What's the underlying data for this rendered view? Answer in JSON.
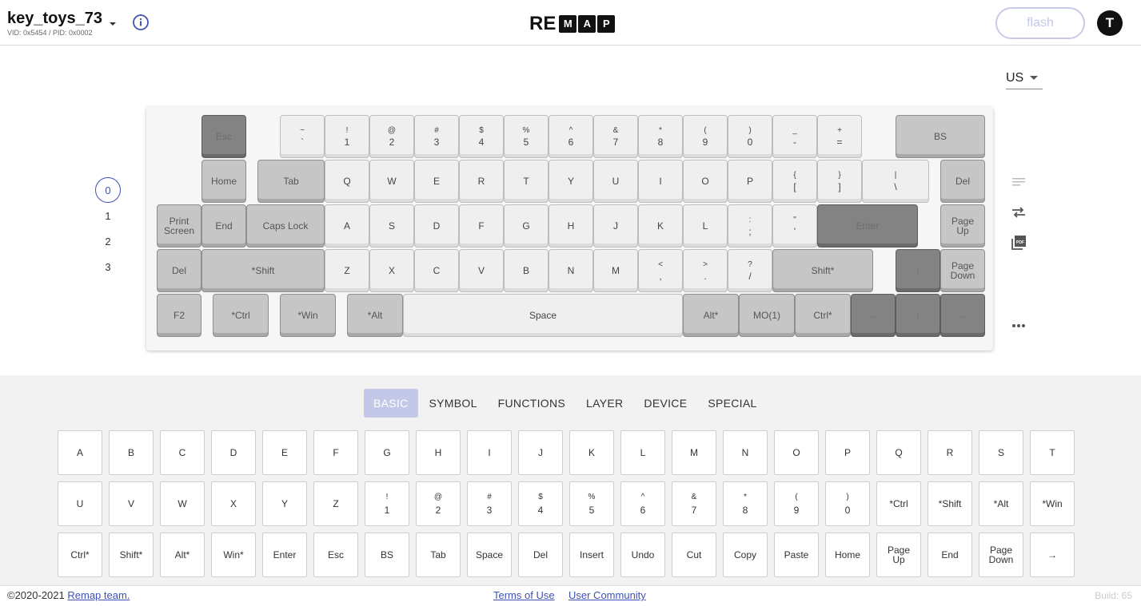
{
  "header": {
    "keyboard_name": "key_toys_73",
    "keyboard_ids": "VID: 0x5454 / PID: 0x0002",
    "logo_re": "RE",
    "logo_letters": [
      "M",
      "A",
      "P"
    ],
    "flash_label": "flash",
    "avatar_initial": "T"
  },
  "keymap": {
    "layout_value": "US",
    "layers": [
      "0",
      "1",
      "2",
      "3"
    ],
    "active_layer": "0",
    "rows": [
      [
        {
          "top": "",
          "label": "Esc",
          "style": "dark"
        },
        {
          "top": "~",
          "label": "`",
          "style": "light"
        },
        {
          "top": "!",
          "label": "1",
          "style": "light"
        },
        {
          "top": "@",
          "label": "2",
          "style": "light"
        },
        {
          "top": "#",
          "label": "3",
          "style": "light"
        },
        {
          "top": "$",
          "label": "4",
          "style": "light"
        },
        {
          "top": "%",
          "label": "5",
          "style": "light"
        },
        {
          "top": "^",
          "label": "6",
          "style": "light"
        },
        {
          "top": "&",
          "label": "7",
          "style": "light"
        },
        {
          "top": "*",
          "label": "8",
          "style": "light"
        },
        {
          "top": "(",
          "label": "9",
          "style": "light"
        },
        {
          "top": ")",
          "label": "0",
          "style": "light"
        },
        {
          "top": "_",
          "label": "-",
          "style": "light"
        },
        {
          "top": "+",
          "label": "=",
          "style": "light"
        },
        {
          "top": "",
          "label": "BS",
          "style": "mid"
        }
      ],
      [
        {
          "top": "",
          "label": "Home",
          "style": "mid"
        },
        {
          "top": "",
          "label": "Tab",
          "style": "mid"
        },
        {
          "top": "",
          "label": "Q",
          "style": "light"
        },
        {
          "top": "",
          "label": "W",
          "style": "light"
        },
        {
          "top": "",
          "label": "E",
          "style": "light"
        },
        {
          "top": "",
          "label": "R",
          "style": "light"
        },
        {
          "top": "",
          "label": "T",
          "style": "light"
        },
        {
          "top": "",
          "label": "Y",
          "style": "light"
        },
        {
          "top": "",
          "label": "U",
          "style": "light"
        },
        {
          "top": "",
          "label": "I",
          "style": "light"
        },
        {
          "top": "",
          "label": "O",
          "style": "light"
        },
        {
          "top": "",
          "label": "P",
          "style": "light"
        },
        {
          "top": "{",
          "label": "[",
          "style": "light"
        },
        {
          "top": "}",
          "label": "]",
          "style": "light"
        },
        {
          "top": "|",
          "label": "\\",
          "style": "light"
        },
        {
          "top": "",
          "label": "Del",
          "style": "mid"
        }
      ],
      [
        {
          "top": "",
          "label": "Print Screen",
          "style": "mid"
        },
        {
          "top": "",
          "label": "End",
          "style": "mid"
        },
        {
          "top": "",
          "label": "Caps Lock",
          "style": "mid"
        },
        {
          "top": "",
          "label": "A",
          "style": "light"
        },
        {
          "top": "",
          "label": "S",
          "style": "light"
        },
        {
          "top": "",
          "label": "D",
          "style": "light"
        },
        {
          "top": "",
          "label": "F",
          "style": "light"
        },
        {
          "top": "",
          "label": "G",
          "style": "light"
        },
        {
          "top": "",
          "label": "H",
          "style": "light"
        },
        {
          "top": "",
          "label": "J",
          "style": "light"
        },
        {
          "top": "",
          "label": "K",
          "style": "light"
        },
        {
          "top": "",
          "label": "L",
          "style": "light"
        },
        {
          "top": ":",
          "label": ";",
          "style": "light"
        },
        {
          "top": "\"",
          "label": "'",
          "style": "light"
        },
        {
          "top": "",
          "label": "Enter",
          "style": "dark"
        },
        {
          "top": "",
          "label": "Page Up",
          "style": "mid"
        }
      ],
      [
        {
          "top": "",
          "label": "Del",
          "style": "mid"
        },
        {
          "top": "",
          "label": "*Shift",
          "style": "mid"
        },
        {
          "top": "",
          "label": "Z",
          "style": "light"
        },
        {
          "top": "",
          "label": "X",
          "style": "light"
        },
        {
          "top": "",
          "label": "C",
          "style": "light"
        },
        {
          "top": "",
          "label": "V",
          "style": "light"
        },
        {
          "top": "",
          "label": "B",
          "style": "light"
        },
        {
          "top": "",
          "label": "N",
          "style": "light"
        },
        {
          "top": "",
          "label": "M",
          "style": "light"
        },
        {
          "top": "<",
          "label": ",",
          "style": "light"
        },
        {
          "top": ">",
          "label": ".",
          "style": "light"
        },
        {
          "top": "?",
          "label": "/",
          "style": "light"
        },
        {
          "top": "",
          "label": "Shift*",
          "style": "mid"
        },
        {
          "top": "",
          "label": "↑",
          "style": "dark"
        },
        {
          "top": "",
          "label": "Page Down",
          "style": "mid"
        }
      ],
      [
        {
          "top": "",
          "label": "F2",
          "style": "mid"
        },
        {
          "top": "",
          "label": "*Ctrl",
          "style": "mid"
        },
        {
          "top": "",
          "label": "*Win",
          "style": "mid"
        },
        {
          "top": "",
          "label": "*Alt",
          "style": "mid"
        },
        {
          "top": "",
          "label": "Space",
          "style": "light"
        },
        {
          "top": "",
          "label": "Alt*",
          "style": "mid"
        },
        {
          "top": "",
          "label": "MO(1)",
          "style": "mid"
        },
        {
          "top": "",
          "label": "Ctrl*",
          "style": "mid"
        },
        {
          "top": "",
          "label": "←",
          "style": "dark"
        },
        {
          "top": "",
          "label": "↓",
          "style": "dark"
        },
        {
          "top": "",
          "label": "→",
          "style": "dark"
        }
      ]
    ]
  },
  "picker": {
    "tabs": [
      "BASIC",
      "SYMBOL",
      "FUNCTIONS",
      "LAYER",
      "DEVICE",
      "SPECIAL"
    ],
    "active_tab": "BASIC",
    "rows": [
      [
        {
          "top": "",
          "label": "A"
        },
        {
          "top": "",
          "label": "B"
        },
        {
          "top": "",
          "label": "C"
        },
        {
          "top": "",
          "label": "D"
        },
        {
          "top": "",
          "label": "E"
        },
        {
          "top": "",
          "label": "F"
        },
        {
          "top": "",
          "label": "G"
        },
        {
          "top": "",
          "label": "H"
        },
        {
          "top": "",
          "label": "I"
        },
        {
          "top": "",
          "label": "J"
        },
        {
          "top": "",
          "label": "K"
        },
        {
          "top": "",
          "label": "L"
        },
        {
          "top": "",
          "label": "M"
        },
        {
          "top": "",
          "label": "N"
        },
        {
          "top": "",
          "label": "O"
        },
        {
          "top": "",
          "label": "P"
        },
        {
          "top": "",
          "label": "Q"
        },
        {
          "top": "",
          "label": "R"
        },
        {
          "top": "",
          "label": "S"
        },
        {
          "top": "",
          "label": "T"
        }
      ],
      [
        {
          "top": "",
          "label": "U"
        },
        {
          "top": "",
          "label": "V"
        },
        {
          "top": "",
          "label": "W"
        },
        {
          "top": "",
          "label": "X"
        },
        {
          "top": "",
          "label": "Y"
        },
        {
          "top": "",
          "label": "Z"
        },
        {
          "top": "!",
          "label": "1"
        },
        {
          "top": "@",
          "label": "2"
        },
        {
          "top": "#",
          "label": "3"
        },
        {
          "top": "$",
          "label": "4"
        },
        {
          "top": "%",
          "label": "5"
        },
        {
          "top": "^",
          "label": "6"
        },
        {
          "top": "&",
          "label": "7"
        },
        {
          "top": "*",
          "label": "8"
        },
        {
          "top": "(",
          "label": "9"
        },
        {
          "top": ")",
          "label": "0"
        },
        {
          "top": "",
          "label": "*Ctrl"
        },
        {
          "top": "",
          "label": "*Shift"
        },
        {
          "top": "",
          "label": "*Alt"
        },
        {
          "top": "",
          "label": "*Win"
        }
      ],
      [
        {
          "top": "",
          "label": "Ctrl*"
        },
        {
          "top": "",
          "label": "Shift*"
        },
        {
          "top": "",
          "label": "Alt*"
        },
        {
          "top": "",
          "label": "Win*"
        },
        {
          "top": "",
          "label": "Enter"
        },
        {
          "top": "",
          "label": "Esc"
        },
        {
          "top": "",
          "label": "BS"
        },
        {
          "top": "",
          "label": "Tab"
        },
        {
          "top": "",
          "label": "Space"
        },
        {
          "top": "",
          "label": "Del"
        },
        {
          "top": "",
          "label": "Insert"
        },
        {
          "top": "",
          "label": "Undo"
        },
        {
          "top": "",
          "label": "Cut"
        },
        {
          "top": "",
          "label": "Copy"
        },
        {
          "top": "",
          "label": "Paste"
        },
        {
          "top": "",
          "label": "Home"
        },
        {
          "top": "",
          "label": "Page Up"
        },
        {
          "top": "",
          "label": "End"
        },
        {
          "top": "",
          "label": "Page Down"
        },
        {
          "top": "",
          "label": "→"
        }
      ]
    ]
  },
  "footer": {
    "copyright": "©2020-2021",
    "team_link": "Remap team.",
    "terms": "Terms of Use",
    "community": "User Community",
    "build": "Build: 65"
  },
  "colors": {
    "accent": "#3f51b5",
    "tab_active_bg": "#c4c8e8"
  }
}
